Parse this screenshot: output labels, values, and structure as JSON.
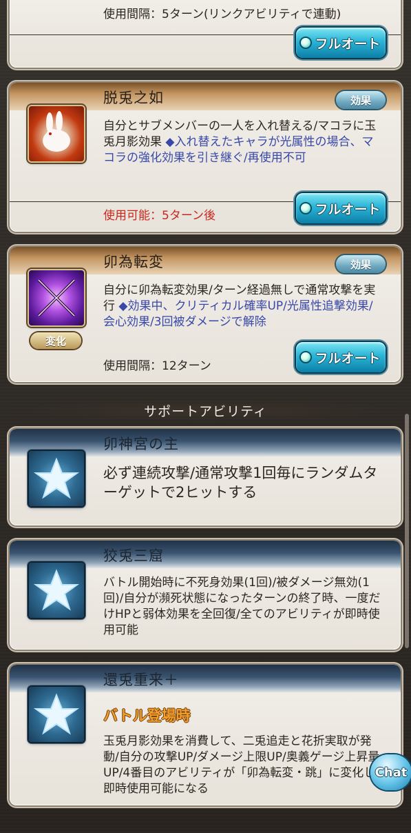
{
  "active_abilities": [
    {
      "title": "",
      "description": [],
      "usage": "使用間隔：5ターン(リンクアビリティで連動)",
      "usage_color": "normal",
      "full_auto_label": "フルオート"
    },
    {
      "title": "脱兎之如",
      "effect_badge": "効果",
      "icon": "rabbit-icon",
      "description_plain": "自分とサブメンバーの一人を入れ替える/マコラに玉兎月影効果",
      "description_blue": "◆入れ替えたキャラが光属性の場合、マコラの強化効果を引き継ぐ/再使用不可",
      "usage": "使用可能：5ターン後",
      "usage_color": "#c8281e",
      "full_auto_label": "フルオート"
    },
    {
      "title": "卯為転変",
      "effect_badge": "効果",
      "icon": "crossed-swords-icon",
      "change_badge": "変化",
      "description_plain": "自分に卯為転変効果/ターン経過無しで通常攻撃を実行",
      "description_blue": "◆効果中、クリティカル確率UP/光属性追撃効果/会心効果/3回被ダメージで解除",
      "usage": "使用間隔：12ターン",
      "full_auto_label": "フルオート"
    }
  ],
  "support_heading": "サポートアビリティ",
  "support_abilities": [
    {
      "title": "卯神宮の主",
      "icon": "star-icon",
      "description": "必ず連続攻撃/通常攻撃1回毎にランダムターゲットで2ヒットする"
    },
    {
      "title": "狡兎三窟",
      "icon": "star-icon",
      "description": "バトル開始時に不死身効果(1回)/被ダメージ無効(1回)/自分が瀕死状態になったターンの終了時、一度だけHPと弱体効果を全回復/全てのアビリティが即時使用可能"
    },
    {
      "title": "還兎重来＋",
      "icon": "star-icon",
      "highlight": "バトル登場時",
      "description": "玉兎月影効果を消費して、二兎追走と花折実取が発動/自分の攻撃UP/ダメージ上限UP/奥義ゲージ上昇量UP/4番目のアビリティが「卯為転変・跳」に変化し即時使用可能になる"
    }
  ],
  "chat_label": "Chat",
  "colors": {
    "accent_cyan": "#2ab4d6",
    "warning_red": "#c8281e",
    "link_blue": "#3848a8",
    "highlight_orange": "#f3a02a"
  }
}
